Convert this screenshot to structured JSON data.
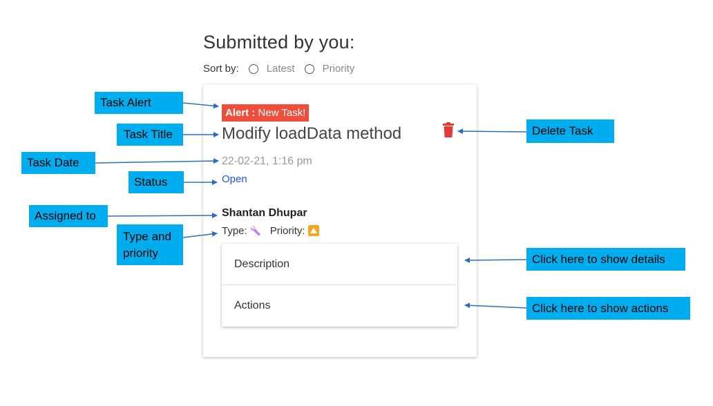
{
  "header": {
    "title": "Submitted by you:",
    "sort_label": "Sort by:",
    "sort_options": [
      "Latest",
      "Priority"
    ]
  },
  "task": {
    "alert_prefix": "Alert :",
    "alert_text": "New Task!",
    "title": "Modify loadData method",
    "date": "22-02-21, 1:16 pm",
    "status": "Open",
    "assignee": "Shantan Dhupar",
    "type_label": "Type:",
    "type_icon": "wrench-icon",
    "priority_label": "Priority:",
    "priority_icon": "priority-up-icon",
    "delete_icon": "trash-icon"
  },
  "accordion": {
    "description_label": "Description",
    "actions_label": "Actions"
  },
  "callouts": {
    "task_alert": "Task Alert",
    "task_title": "Task Title",
    "task_date": "Task Date",
    "status": "Status",
    "assigned_to": "Assigned to",
    "type_priority_line1": "Type and",
    "type_priority_line2": "priority",
    "delete_task": "Delete Task",
    "show_details": "Click here to show details",
    "show_actions": "Click here to show actions"
  },
  "colors": {
    "alert_bg": "#ef4e3c",
    "status": "#2451e0",
    "callout_bg": "#00aeef",
    "arrow": "#2e6bc4",
    "priority_badge": "#f5a623",
    "type_icon": "#c27ee8"
  }
}
